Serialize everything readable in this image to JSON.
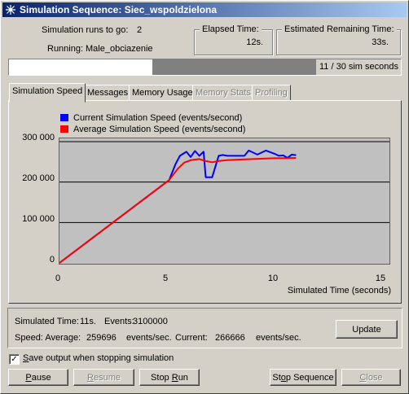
{
  "window": {
    "title": "Simulation Sequence: Siec_wspoldzielona"
  },
  "info": {
    "runs_to_go_label": "Simulation runs to go:",
    "runs_to_go_value": "2",
    "running_label": "Running:",
    "running_value": "Male_obciazenie"
  },
  "elapsed": {
    "title": "Elapsed Time:",
    "value": "12s."
  },
  "remaining": {
    "title": "Estimated Remaining Time:",
    "value": "33s."
  },
  "progress": {
    "text": "11 / 30 sim seconds",
    "current": 11,
    "total": 30
  },
  "tabs": [
    {
      "label": "Simulation Speed",
      "active": true,
      "enabled": true
    },
    {
      "label": "Messages",
      "active": false,
      "enabled": true
    },
    {
      "label": "Memory Usage",
      "active": false,
      "enabled": true
    },
    {
      "label": "Memory Stats",
      "active": false,
      "enabled": false
    },
    {
      "label": "Profiling",
      "active": false,
      "enabled": false
    }
  ],
  "chart_data": {
    "type": "line",
    "xlabel": "Simulated Time (seconds)",
    "ylabel": "",
    "xlim": [
      0,
      15
    ],
    "ylim": [
      0,
      300000
    ],
    "x_ticks": [
      "0",
      "5",
      "10",
      "15"
    ],
    "y_ticks": [
      "300 000",
      "200 000",
      "100 000",
      "0"
    ],
    "grid": "horizontal",
    "legend_position": "top-left",
    "series": [
      {
        "name": "Current Simulation Speed (events/second)",
        "color": "#0000ff",
        "x": [
          0,
          5.1,
          5.4,
          5.6,
          5.9,
          6.1,
          6.3,
          6.5,
          6.7,
          6.8,
          7.1,
          7.4,
          7.6,
          7.8,
          8.2,
          8.6,
          8.8,
          9.2,
          9.6,
          10.0,
          10.2,
          10.4,
          10.6,
          10.8,
          11.0
        ],
        "y": [
          0,
          205000,
          245000,
          265000,
          275000,
          262000,
          277000,
          265000,
          275000,
          212000,
          212000,
          265000,
          267000,
          265000,
          265000,
          265000,
          278000,
          268000,
          278000,
          270000,
          265000,
          266000,
          260000,
          268000,
          266666
        ]
      },
      {
        "name": "Average Simulation Speed (events/second)",
        "color": "#ff0000",
        "x": [
          0,
          5.1,
          5.5,
          5.8,
          6.1,
          6.5,
          6.8,
          7.1,
          7.4,
          7.8,
          8.5,
          9.0,
          9.5,
          10.0,
          10.5,
          11.0
        ],
        "y": [
          0,
          205000,
          233000,
          248000,
          254000,
          257000,
          252000,
          249000,
          252000,
          254000,
          256000,
          257000,
          258000,
          259000,
          259000,
          259696
        ]
      }
    ]
  },
  "status": {
    "sim_time_label": "Simulated Time:",
    "sim_time_value": "11s.",
    "events_label": "Events:",
    "events_value": "3100000",
    "speed_avg_label": "Speed: Average:",
    "speed_avg_value": "259696",
    "events_per_sec_1": "events/sec.",
    "current_label": "Current:",
    "speed_current_value": "266666",
    "events_per_sec_2": "events/sec."
  },
  "update_label": "Update",
  "save_output": {
    "label": "Save output when stopping simulation",
    "checked": true
  },
  "buttons": {
    "pause": "Pause",
    "resume": "Resume",
    "stop_run": "Stop Run",
    "stop_sequence": "Stop Sequence",
    "close": "Close"
  },
  "colors": {
    "titlebar_start": "#0a246a",
    "titlebar_end": "#a6caf0",
    "face": "#d4d0c8",
    "plot_bg": "#c0c0c0"
  }
}
